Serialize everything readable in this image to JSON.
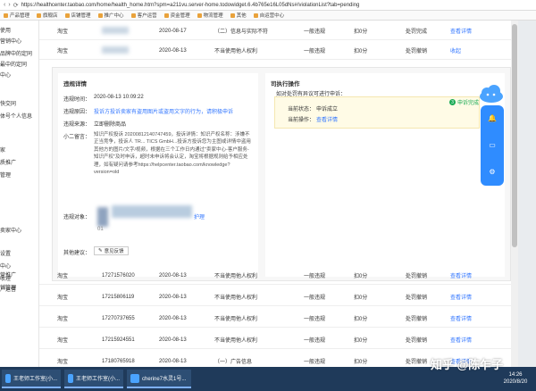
{
  "browser": {
    "url": "https://healthcenter.taobao.com/home/health_home.htm?spm=a211vu.server-home.todowidget.6.4b765e16L05dNs#/violationList?tab=pending",
    "bookmarks": [
      "产品管理",
      "旗舰店",
      "店铺管理",
      "推广中心",
      "客户运营",
      "资金管理",
      "物流管理",
      "其他",
      "自运营中心"
    ]
  },
  "sidebar": {
    "items": [
      "使用",
      "营销中心",
      "品牌中的定同",
      "最中的定同",
      "中心",
      "快交同",
      "体号个人信息",
      "",
      "家",
      "",
      "质推广",
      "管理",
      "",
      "",
      "卖家中心",
      "",
      "设置",
      "",
      "中心",
      "",
      "收理",
      "",
      "户运营",
      "",
      "营推广",
      "销管理"
    ]
  },
  "top_rows": [
    {
      "shop": "淘宝",
      "date": "2020-08-17",
      "reason": "（二）信息与实际不符",
      "level": "一般违规",
      "points": "扣0分",
      "measure": "",
      "status": "处罚完成",
      "action": "查看详情"
    },
    {
      "shop": "淘宝",
      "date": "2020-08-13",
      "reason": "不当使用他人权利",
      "level": "一般违规",
      "points": "扣0分",
      "measure": "",
      "status": "处罚撤销",
      "action": "收起"
    }
  ],
  "detail": {
    "title": "违规详情",
    "time_label": "违规时间：",
    "time_value": "2020-08-13 10:09:22",
    "type_label": "违规原因：",
    "type_value": "投诉方投诉卖家有盗用图片或盗用文字的行为，请积极申诉",
    "source_label": "违规来源：",
    "source_value": "立即删除商品",
    "desc_label": "小二留言：",
    "desc_value": "知识产权投诉  20200812140747459，投诉详情：知识产权名称：涉嫌不正当竞争，投诉人 TR... TICS GmbH...投诉方投诉您为主图或详情中盗用其他方的图片/文字/视频，根据在三个工作日内通过\"卖家中心-客户服务-知识产权\"及时申诉，超时未申诉将会认定，淘宝将根据规则给予相应处理，如有疑问请参考https://helpcenter.taobao.com/knowledge?version=old",
    "person_label": "违规对象：",
    "other_label": "其他建议：",
    "feedback_label": "意见反馈",
    "blur_link": "护理",
    "blur_code": "01"
  },
  "execution": {
    "title": "司执行操作",
    "question": "如对处罚有异议可进行申诉：",
    "step_status": "申诉完成",
    "status_label": "当前状态：",
    "status_value": "申诉成立",
    "op_label": "当前操作：",
    "op_value": "查看详情"
  },
  "bottom_rows": [
    {
      "shop": "淘宝",
      "id": "17271576020",
      "date": "2020-08-13",
      "reason": "不当使用他人权利",
      "level": "一般违规",
      "points": "扣0分",
      "status": "处罚撤销",
      "action": "查看详情"
    },
    {
      "shop": "淘宝",
      "id": "17215806119",
      "date": "2020-08-13",
      "reason": "不当使用他人权利",
      "level": "一般违规",
      "points": "扣0分",
      "status": "处罚撤销",
      "action": "查看详情"
    },
    {
      "shop": "淘宝",
      "id": "17270737655",
      "date": "2020-08-13",
      "reason": "不当使用他人权利",
      "level": "一般违规",
      "points": "扣0分",
      "status": "处罚撤销",
      "action": "查看详情"
    },
    {
      "shop": "淘宝",
      "id": "17215924551",
      "date": "2020-08-13",
      "reason": "不当使用他人权利",
      "level": "一般违规",
      "points": "扣0分",
      "status": "处罚撤销",
      "action": "查看详情"
    },
    {
      "shop": "淘宝",
      "id": "17180765918",
      "date": "2020-08-13",
      "reason": "（一）广告信息",
      "level": "一般违规",
      "points": "扣0分",
      "status": "处罚撤销",
      "action": "查看详情"
    }
  ],
  "taskbar": {
    "tasks": [
      "王老师工作室(小...",
      "王老师工作室(小...",
      "cherine7水灵1号..."
    ],
    "time": "14:26",
    "date": "2020/8/20"
  },
  "watermark": "知乎 @陈乍子",
  "colors": {
    "link": "#3377ff",
    "accent": "#2f8cff",
    "success": "#1aaa55",
    "taskbar": "#1f3a5a"
  }
}
